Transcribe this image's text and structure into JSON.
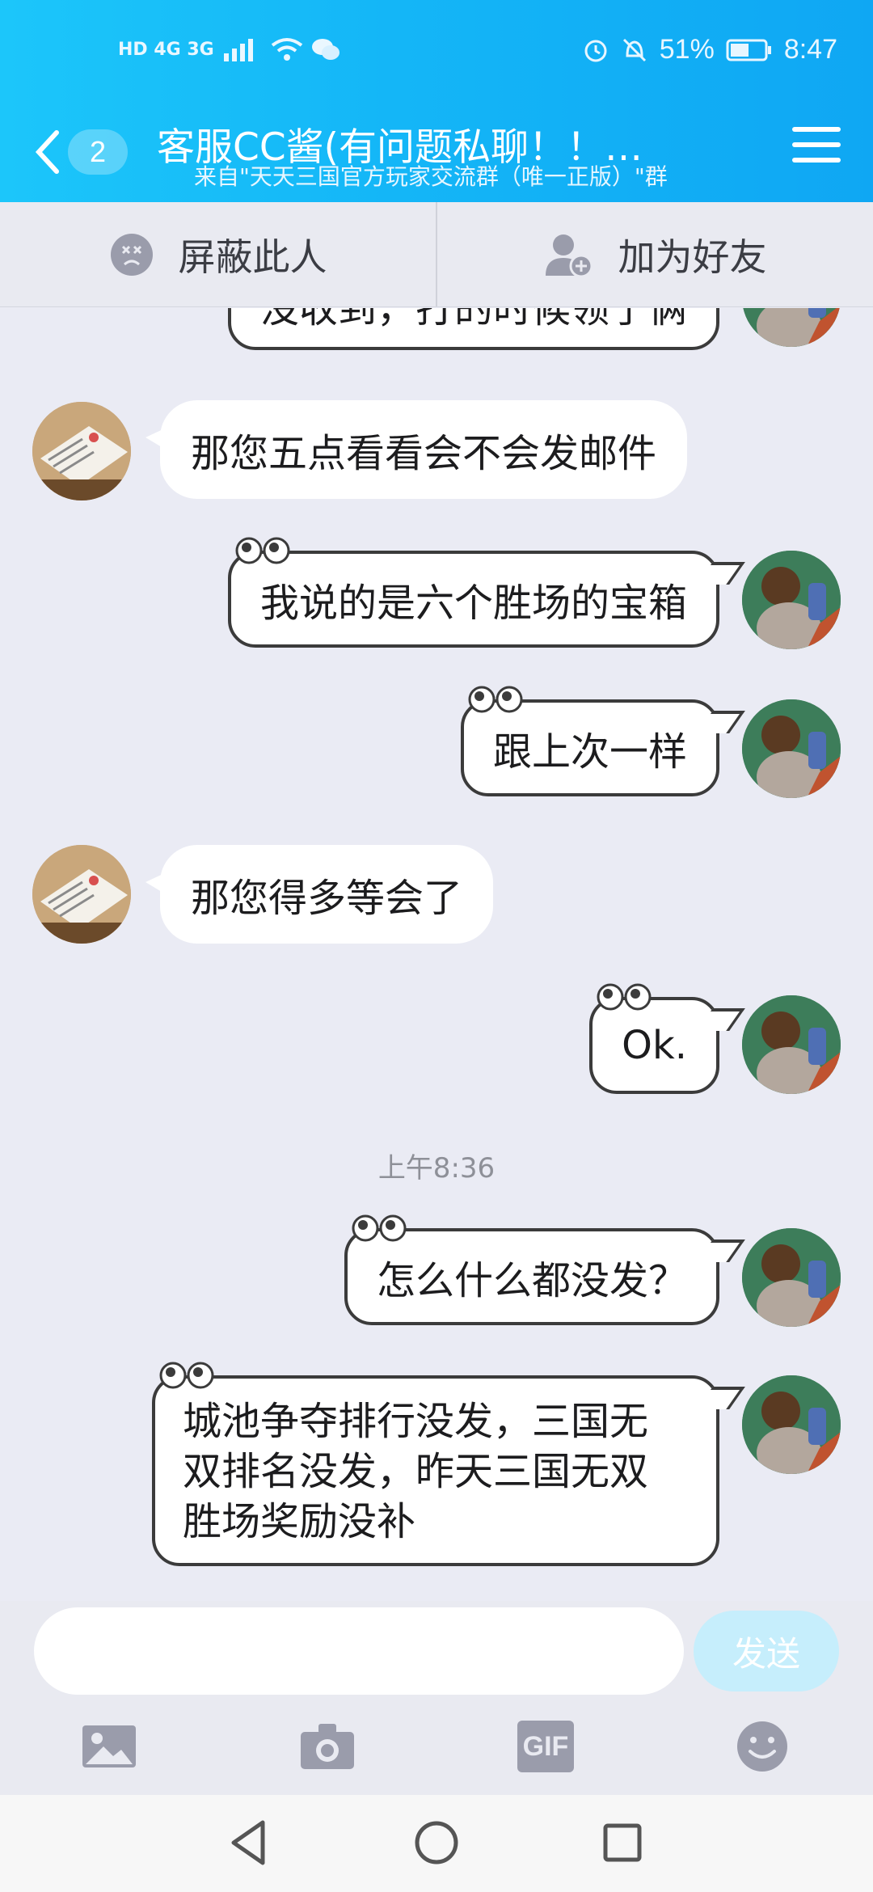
{
  "status_bar": {
    "left_indicators": "HD 4G 3G",
    "battery_percent": "51%",
    "time": "8:47"
  },
  "header": {
    "unread_count": "2",
    "title": "客服CC酱(有问题私聊！！…",
    "subtitle": "来自\"天天三国官方玩家交流群（唯一正版）\"群"
  },
  "actions": {
    "block_label": "屏蔽此人",
    "add_friend_label": "加为好友"
  },
  "messages": [
    {
      "side": "right",
      "text": "没收到，打的时候领了俩"
    },
    {
      "side": "left",
      "text": "那您五点看看会不会发邮件"
    },
    {
      "side": "right",
      "text": "我说的是六个胜场的宝箱"
    },
    {
      "side": "right",
      "text": "跟上次一样"
    },
    {
      "side": "left",
      "text": "那您得多等会了"
    },
    {
      "side": "right",
      "text": "Ok."
    },
    {
      "type": "timestamp",
      "text": "上午8:36"
    },
    {
      "side": "right",
      "text": "怎么什么都没发？"
    },
    {
      "side": "right",
      "lines": [
        "城池争夺排行没发，三国无",
        "双排名没发，昨天三国无双",
        "胜场奖励没补"
      ]
    }
  ],
  "input": {
    "value": "",
    "send_label": "发送"
  },
  "toolbar": {
    "gif_label": "GIF",
    "icons": [
      "image-icon",
      "camera-icon",
      "gif-icon",
      "emoji-icon"
    ]
  },
  "colors": {
    "header_start": "#1cc6fa",
    "header_end": "#0fa7f3",
    "chat_bg": "#eaebf4",
    "send_button": "#c6eefc",
    "icon_gray": "#9a9cab"
  }
}
